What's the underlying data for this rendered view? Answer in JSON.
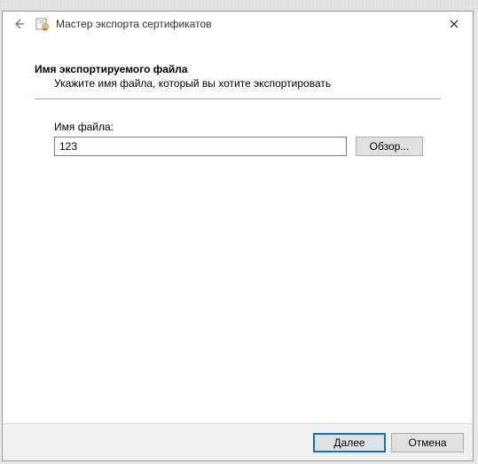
{
  "window": {
    "title": "Мастер экспорта сертификатов"
  },
  "page": {
    "heading": "Имя экспортируемого файла",
    "subheading": "Укажите имя файла, который вы хотите экспортировать"
  },
  "field": {
    "label": "Имя файла:",
    "value": "123",
    "browse_label": "Обзор..."
  },
  "footer": {
    "next_label": "Далее",
    "cancel_label": "Отмена"
  }
}
